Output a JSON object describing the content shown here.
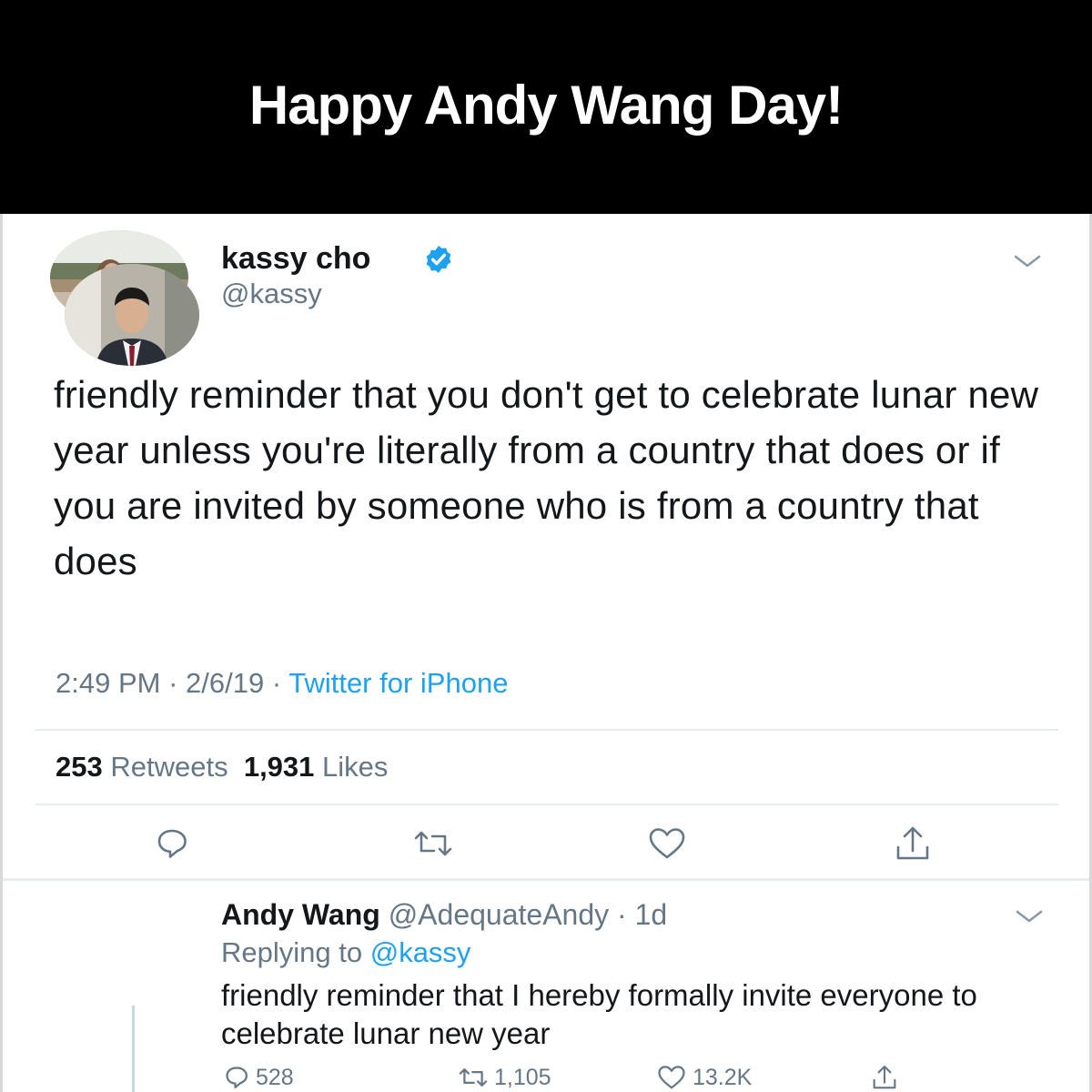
{
  "banner": {
    "title": "Happy Andy Wang Day!"
  },
  "tweet": {
    "author_name": "kassy cho",
    "author_handle": "@kassy",
    "verified": true,
    "text": "friendly reminder that you don't get to celebrate lunar new year unless you're literally from a country that does or if you are invited by someone who is from a country that does",
    "time": "2:49 PM",
    "date": "2/6/19",
    "client": "Twitter for iPhone",
    "retweets_count": "253",
    "retweets_label": "Retweets",
    "likes_count": "1,931",
    "likes_label": "Likes",
    "actions": [
      "reply-icon",
      "retweet-icon",
      "like-icon",
      "share-icon"
    ]
  },
  "reply": {
    "author_name": "Andy Wang",
    "author_handle": "@AdequateAndy",
    "age": "1d",
    "replying_prefix": "Replying to",
    "replying_to": "@kassy",
    "text": "friendly reminder that I hereby formally invite everyone to celebrate lunar new year",
    "reply_count": "528",
    "retweet_count": "1,105",
    "like_count": "13.2K"
  },
  "colors": {
    "banner_bg": "#000000",
    "text_primary": "#14171a",
    "text_secondary": "#657786",
    "link_blue": "#1da1f2"
  }
}
